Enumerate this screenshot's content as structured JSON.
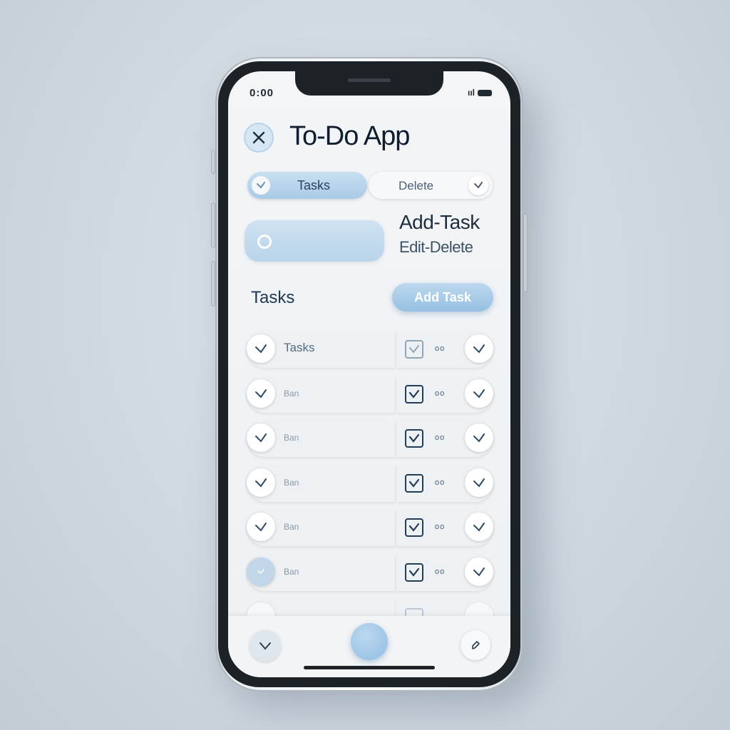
{
  "status_bar": {
    "time": "0:00",
    "signal": "ııl"
  },
  "header": {
    "title": "To-Do App",
    "close_icon": "close-icon"
  },
  "segments": {
    "tasks_label": "Tasks",
    "delete_label": "Delete"
  },
  "input_area": {
    "add_task_label": "Add-Task",
    "edit_delete_label": "Edit-Delete"
  },
  "section": {
    "title": "Tasks",
    "add_button_label": "Add Task"
  },
  "tasks": [
    {
      "text": "Tasks",
      "dots": "oo",
      "checked": true
    },
    {
      "text": "Ban",
      "dots": "oo",
      "checked": true
    },
    {
      "text": "Ban",
      "dots": "oo",
      "checked": true
    },
    {
      "text": "Ban",
      "dots": "oo",
      "checked": true
    },
    {
      "text": "Ban",
      "dots": "oo",
      "checked": true
    },
    {
      "text": "Ban",
      "dots": "oo",
      "checked": true
    },
    {
      "text": "",
      "dots": "",
      "checked": false
    }
  ],
  "bottom_nav": {
    "left_icon": "chevron-down-icon",
    "center_icon": "add-circle-icon",
    "right_icon": "edit-icon"
  },
  "colors": {
    "accent": "#a9cbe6",
    "accent_dark": "#243c55",
    "background": "#cdd6de",
    "screen": "#f3f5f7"
  }
}
